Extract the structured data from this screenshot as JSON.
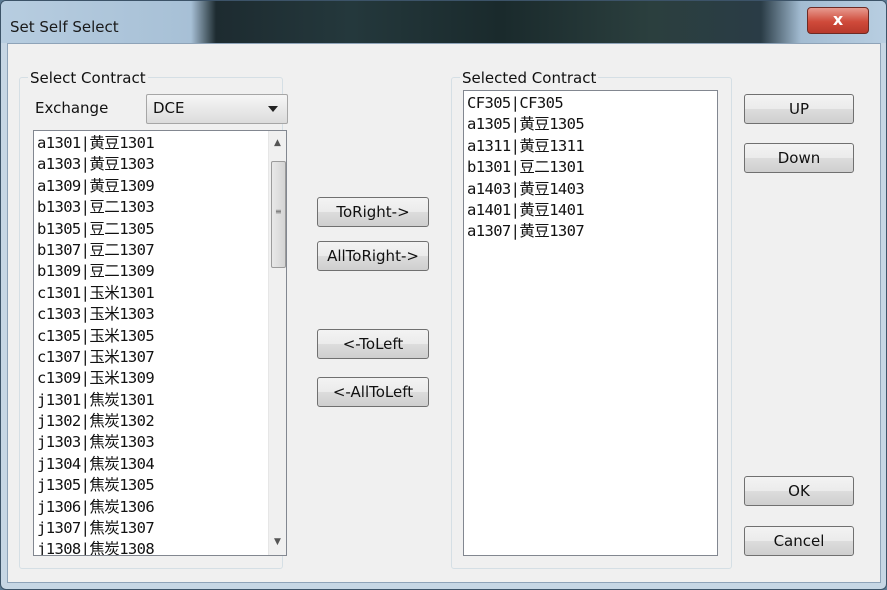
{
  "window": {
    "title": "Set Self Select",
    "close_symbol": "x"
  },
  "left_group": {
    "label": "Select Contract",
    "exchange_label": "Exchange",
    "exchange_value": "DCE",
    "items": [
      "a1301|黄豆1301",
      "a1303|黄豆1303",
      "a1309|黄豆1309",
      "b1303|豆二1303",
      "b1305|豆二1305",
      "b1307|豆二1307",
      "b1309|豆二1309",
      "c1301|玉米1301",
      "c1303|玉米1303",
      "c1305|玉米1305",
      "c1307|玉米1307",
      "c1309|玉米1309",
      "j1301|焦炭1301",
      "j1302|焦炭1302",
      "j1303|焦炭1303",
      "j1304|焦炭1304",
      "j1305|焦炭1305",
      "j1306|焦炭1306",
      "j1307|焦炭1307",
      "j1308|焦炭1308"
    ]
  },
  "right_group": {
    "label": "Selected Contract",
    "items": [
      "CF305|CF305",
      "a1305|黄豆1305",
      "a1311|黄豆1311",
      "b1301|豆二1301",
      "a1403|黄豆1403",
      "a1401|黄豆1401",
      "a1307|黄豆1307"
    ]
  },
  "buttons": {
    "to_right": "ToRight->",
    "all_to_right": "AllToRight->",
    "to_left": "<-ToLeft",
    "all_to_left": "<-AllToLeft",
    "up": "UP",
    "down": "Down",
    "ok": "OK",
    "cancel": "Cancel"
  },
  "icons": {
    "scroll_up": "▲",
    "scroll_down": "▼",
    "grip": "≡"
  }
}
